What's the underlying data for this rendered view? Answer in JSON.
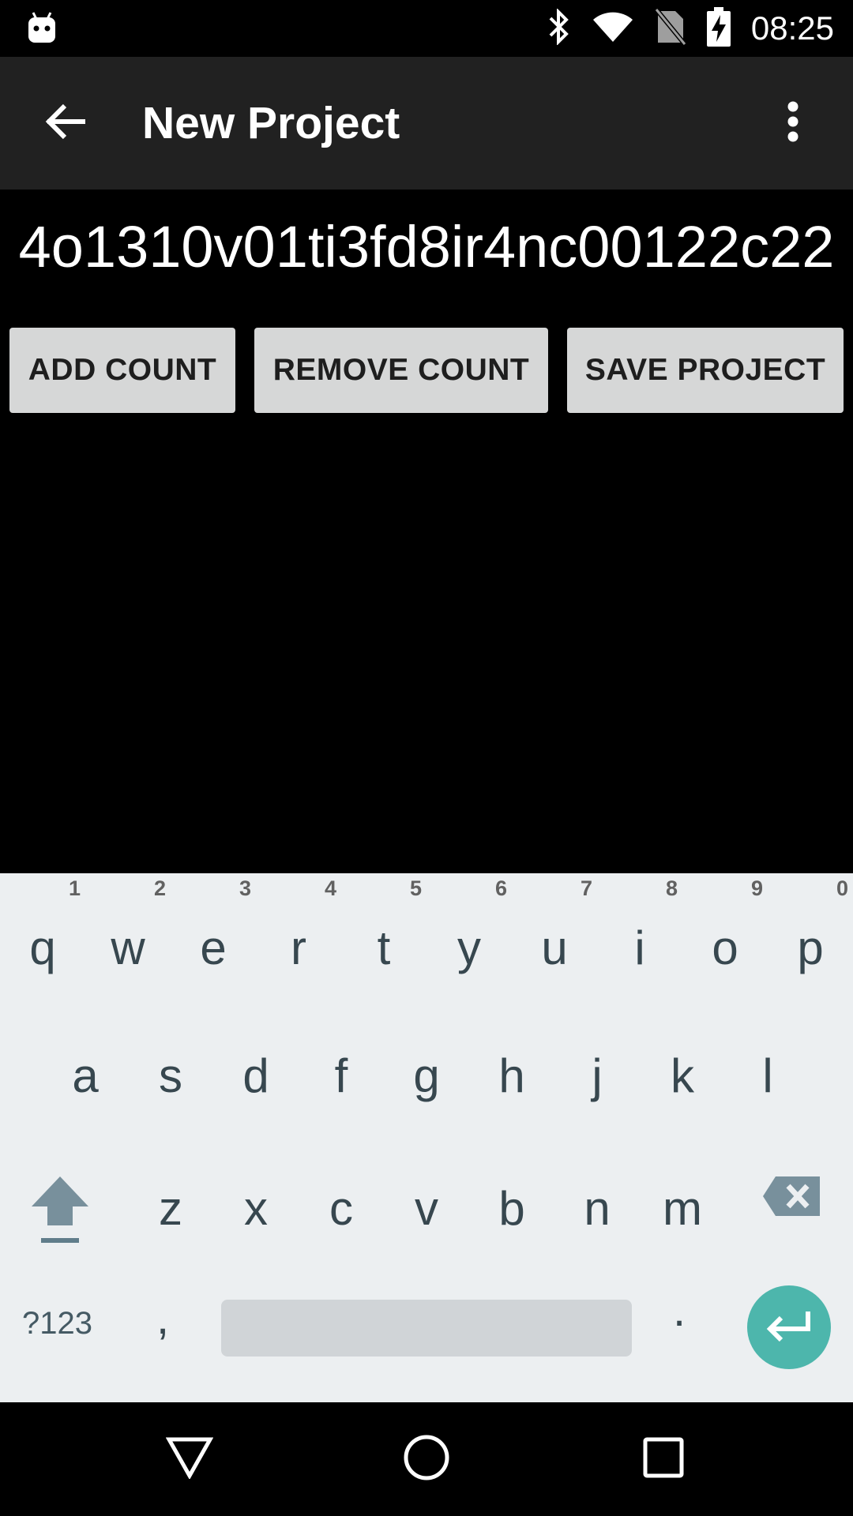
{
  "status_bar": {
    "time": "08:25",
    "icons": [
      "android-notification-icon",
      "bluetooth-icon",
      "wifi-icon",
      "no-sim-icon",
      "battery-charging-icon"
    ]
  },
  "app_bar": {
    "title": "New Project",
    "back_icon": "arrow-back-icon",
    "overflow_icon": "more-vert-icon"
  },
  "project": {
    "id_text": "4o1310v01ti3fd8ir4nc00122c22"
  },
  "buttons": {
    "add_count": "ADD COUNT",
    "remove_count": "REMOVE COUNT",
    "save_project": "SAVE PROJECT"
  },
  "keyboard": {
    "row1": [
      {
        "key": "q",
        "hint": "1"
      },
      {
        "key": "w",
        "hint": "2"
      },
      {
        "key": "e",
        "hint": "3"
      },
      {
        "key": "r",
        "hint": "4"
      },
      {
        "key": "t",
        "hint": "5"
      },
      {
        "key": "y",
        "hint": "6"
      },
      {
        "key": "u",
        "hint": "7"
      },
      {
        "key": "i",
        "hint": "8"
      },
      {
        "key": "o",
        "hint": "9"
      },
      {
        "key": "p",
        "hint": "0"
      }
    ],
    "row2": [
      "a",
      "s",
      "d",
      "f",
      "g",
      "h",
      "j",
      "k",
      "l"
    ],
    "row3": [
      "z",
      "x",
      "c",
      "v",
      "b",
      "n",
      "m"
    ],
    "symbols_label": "?123",
    "comma_label": ",",
    "period_label": ".",
    "enter_color": "#4db6ac",
    "background_color": "#eceff1"
  },
  "nav_bar": {
    "icons": [
      "back-triangle-icon",
      "home-circle-icon",
      "recents-square-icon"
    ]
  },
  "colors": {
    "app_bar": "#212121",
    "button_bg": "#d6d7d7",
    "background": "#000000"
  }
}
